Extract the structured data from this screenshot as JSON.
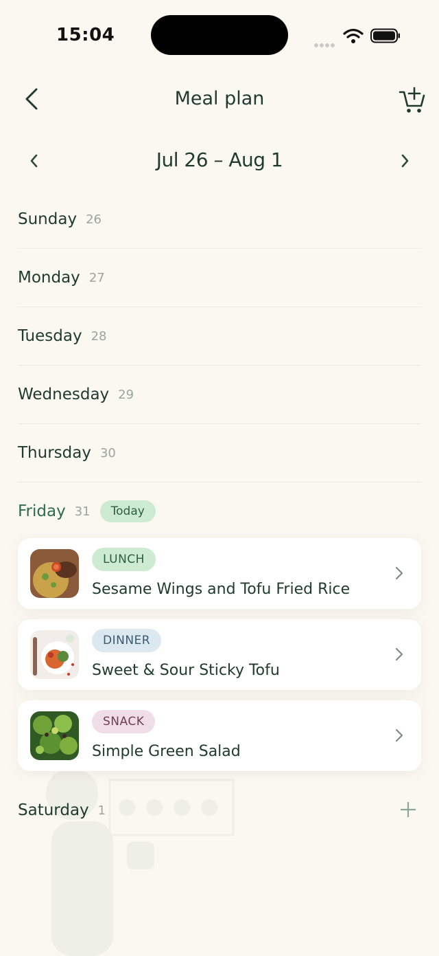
{
  "status_bar": {
    "time": "15:04"
  },
  "header": {
    "title": "Meal plan"
  },
  "week": {
    "label": "Jul 26 – Aug 1"
  },
  "days": [
    {
      "name": "Sunday",
      "num": "26"
    },
    {
      "name": "Monday",
      "num": "27"
    },
    {
      "name": "Tuesday",
      "num": "28"
    },
    {
      "name": "Wednesday",
      "num": "29"
    },
    {
      "name": "Thursday",
      "num": "30"
    }
  ],
  "today": {
    "name": "Friday",
    "num": "31",
    "badge": "Today"
  },
  "meals": [
    {
      "tag": "LUNCH",
      "title": "Sesame Wings and Tofu Fried Rice"
    },
    {
      "tag": "DINNER",
      "title": "Sweet & Sour Sticky Tofu"
    },
    {
      "tag": "SNACK",
      "title": "Simple Green Salad"
    }
  ],
  "saturday": {
    "name": "Saturday",
    "num": "1"
  },
  "colors": {
    "background": "#FAF8F1",
    "accent_green": "#2E6B4A",
    "lunch_tag": "#CDEBD0",
    "dinner_tag": "#DCE8F0",
    "snack_tag": "#F1DDE6"
  },
  "icons": [
    "back-arrow-icon",
    "cart-add-icon",
    "chevron-left-icon",
    "chevron-right-icon",
    "plus-icon",
    "wifi-icon",
    "battery-icon"
  ]
}
